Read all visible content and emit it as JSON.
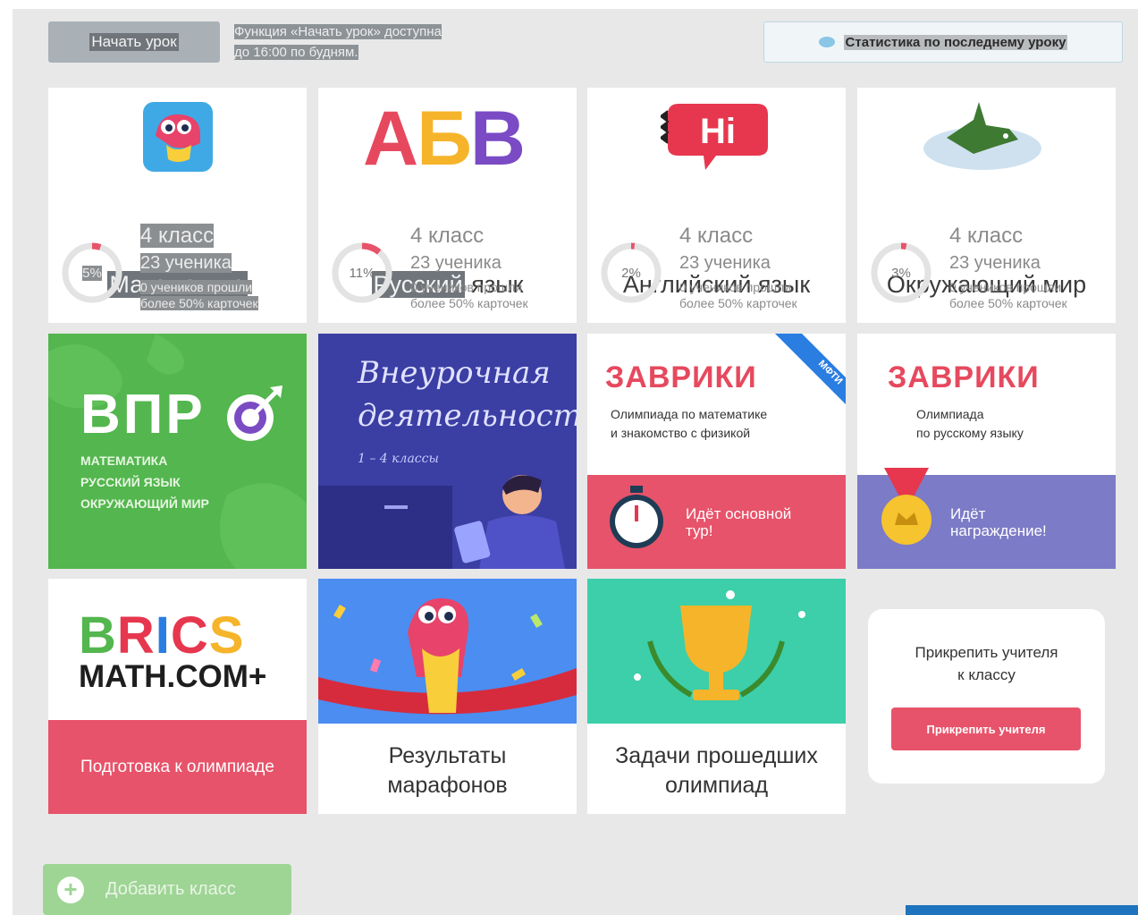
{
  "topbar": {
    "start_lesson": "Начать урок",
    "notice_line1": "Функция «Начать урок» доступна",
    "notice_line2": "до 16:00 по будням.",
    "stats": "Статистика по последнему уроку"
  },
  "subjects": [
    {
      "title": "Математика",
      "grade": "4 класс",
      "students": "23 ученика",
      "note1": "0 учеников прошли",
      "note2": "более 50% карточек",
      "percent": "5%",
      "progress": 0.05
    },
    {
      "title_a": "Русский",
      "title_b": " язык",
      "grade": "4 класс",
      "students": "23 ученика",
      "note1": "0 учеников прошли",
      "note2": "более 50% карточек",
      "percent": "11%",
      "progress": 0.11,
      "logo": "АБВ"
    },
    {
      "title": "Английский язык",
      "grade": "4 класс",
      "students": "23 ученика",
      "note1": "0 учеников прошли",
      "note2": "более 50% карточек",
      "percent": "2%",
      "progress": 0.02,
      "logo": "Hi"
    },
    {
      "title": "Окружающий мир",
      "grade": "4 класс",
      "students": "23 ученика",
      "note1": "0 учеников прошли",
      "note2": "более 50% карточек",
      "percent": "3%",
      "progress": 0.03
    }
  ],
  "vpr": {
    "title": "ВПР",
    "line1": "МАТЕМАТИКА",
    "line2": "РУССКИЙ ЯЗЫК",
    "line3": "ОКРУЖАЮЩИЙ МИР"
  },
  "extracurricular": {
    "line1": "Внеурочная",
    "line2": "деятельность",
    "line3": "1 – 4 классы"
  },
  "zavriki_math": {
    "logo": "ЗАВРИКИ",
    "desc1": "Олимпиада по математике",
    "desc2": "и знакомство с физикой",
    "status1": "Идёт основной",
    "status2": "тур!",
    "ribbon": "МФТИ"
  },
  "zavriki_rus": {
    "logo": "ЗАВРИКИ",
    "desc1": "Олимпиада",
    "desc2": "по русскому языку",
    "status1": "Идёт",
    "status2": "награждение!"
  },
  "brics": {
    "line1_a": "B",
    "line1_b": "R",
    "line1_c": "I",
    "line1_d": "C",
    "line1_e": "S",
    "line2": "MATH.COM+",
    "band": "Подготовка к олимпиаде"
  },
  "marathons": {
    "line1": "Результаты",
    "line2": "марафонов"
  },
  "past_olympiads": {
    "line1": "Задачи прошедших",
    "line2": "олимпиад"
  },
  "attach_teacher": {
    "line1": "Прикрепить учителя",
    "line2": "к классу",
    "button": "Прикрепить учителя"
  },
  "add_class": {
    "label": "Добавить класс"
  },
  "colors": {
    "accent_red": "#e7536a",
    "green": "#53b64e",
    "purple": "#7b7bc7",
    "teal": "#3ccfa9"
  }
}
